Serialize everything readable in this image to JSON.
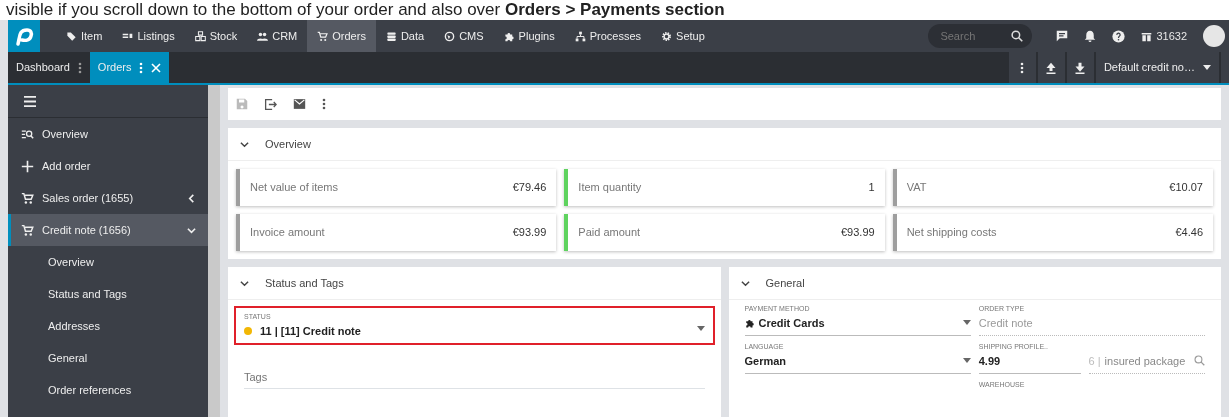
{
  "caption": "visible if you scroll down to the bottom of your order and also over **Orders > Payments section**",
  "nav": {
    "items": [
      {
        "label": "Item",
        "selected": false
      },
      {
        "label": "Listings",
        "selected": false
      },
      {
        "label": "Stock",
        "selected": false
      },
      {
        "label": "CRM",
        "selected": false
      },
      {
        "label": "Orders",
        "selected": true
      },
      {
        "label": "Data",
        "selected": false
      },
      {
        "label": "CMS",
        "selected": false
      },
      {
        "label": "Plugins",
        "selected": false
      },
      {
        "label": "Processes",
        "selected": false
      },
      {
        "label": "Setup",
        "selected": false
      }
    ],
    "search_placeholder": "Search",
    "user_id": "31632"
  },
  "tabs": [
    {
      "label": "Dashboard",
      "selected": false,
      "closable": false
    },
    {
      "label": "Orders",
      "selected": true,
      "closable": true
    }
  ],
  "view_selector": "Default credit no…",
  "sidebar": {
    "items": [
      {
        "label": "Overview",
        "selected": false
      },
      {
        "label": "Add order",
        "selected": false
      },
      {
        "label": "Sales order (1655)",
        "selected": false,
        "expanded": false
      },
      {
        "label": "Credit note (1656)",
        "selected": true,
        "expanded": true,
        "children": [
          {
            "label": "Overview"
          },
          {
            "label": "Status and Tags"
          },
          {
            "label": "Addresses"
          },
          {
            "label": "General"
          },
          {
            "label": "Order references"
          }
        ]
      }
    ]
  },
  "overview": {
    "title": "Overview",
    "expanded": true,
    "stats": [
      {
        "label": "Net value of items",
        "value": "€79.46",
        "color": "#9e9e9e"
      },
      {
        "label": "Item quantity",
        "value": "1",
        "color": "#5fd35f"
      },
      {
        "label": "VAT",
        "value": "€10.07",
        "color": "#9e9e9e"
      },
      {
        "label": "Invoice amount",
        "value": "€93.99",
        "color": "#9e9e9e"
      },
      {
        "label": "Paid amount",
        "value": "€93.99",
        "color": "#5fd35f"
      },
      {
        "label": "Net shipping costs",
        "value": "€4.46",
        "color": "#9e9e9e"
      }
    ]
  },
  "status_tags": {
    "title": "Status and Tags",
    "expanded": true,
    "status": {
      "label": "STATUS",
      "value": "11 | [11] Credit note",
      "color": "#f2b705",
      "highlighted": true
    },
    "tags": {
      "placeholder": "Tags"
    }
  },
  "general": {
    "title": "General",
    "expanded": true,
    "fields": [
      {
        "label": "PAYMENT METHOD",
        "value": "Credit Cards",
        "kind": "select"
      },
      {
        "label": "ORDER TYPE",
        "value": "Credit note",
        "kind": "readonly"
      },
      {
        "label": "LANGUAGE",
        "value": "German",
        "kind": "select"
      },
      {
        "label": "SHIPPING PROFILE..",
        "value": "4.99",
        "kind": "profile",
        "profile_number": "6 |",
        "profile_name": "insured package"
      },
      {
        "label": "WAREHOUSE",
        "kind": "label"
      }
    ]
  }
}
